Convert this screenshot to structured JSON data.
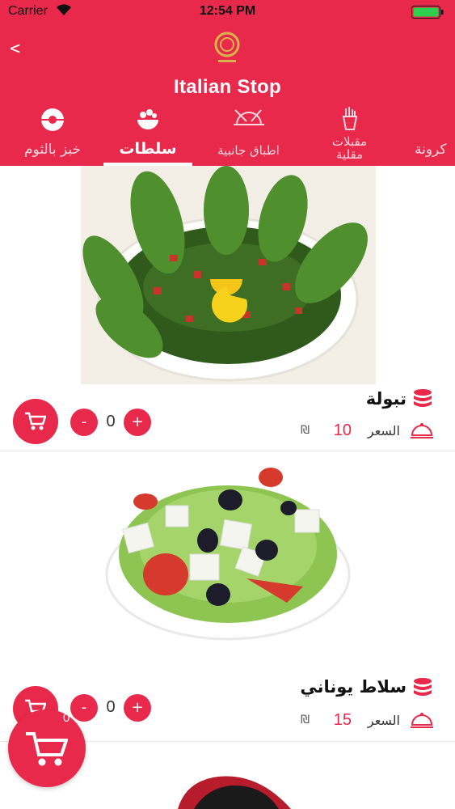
{
  "status": {
    "carrier": "Carrier",
    "time": "12:54 PM"
  },
  "header": {
    "back_label": "<",
    "title": "Italian Stop"
  },
  "tabs": [
    {
      "label": "كرونة",
      "icon": "pasta-icon"
    },
    {
      "label": "مقبلات مقلية",
      "icon": "fries-icon"
    },
    {
      "label": "اطباق جانبية",
      "icon": "plate-icon"
    },
    {
      "label": "سلطات",
      "icon": "salad-icon",
      "active": true
    },
    {
      "label": "خبز بالثوم",
      "icon": "bread-icon"
    }
  ],
  "items": [
    {
      "name": "تبولة",
      "price_label": "السعر",
      "price": "10",
      "currency": "₪",
      "qty": "0",
      "minus": "-",
      "plus": "+"
    },
    {
      "name": "سلاط يوناني",
      "price_label": "السعر",
      "price": "15",
      "currency": "₪",
      "qty": "0",
      "minus": "-",
      "plus": "+"
    }
  ],
  "cart": {
    "count": "0"
  },
  "colors": {
    "brand": "#e8294b"
  }
}
